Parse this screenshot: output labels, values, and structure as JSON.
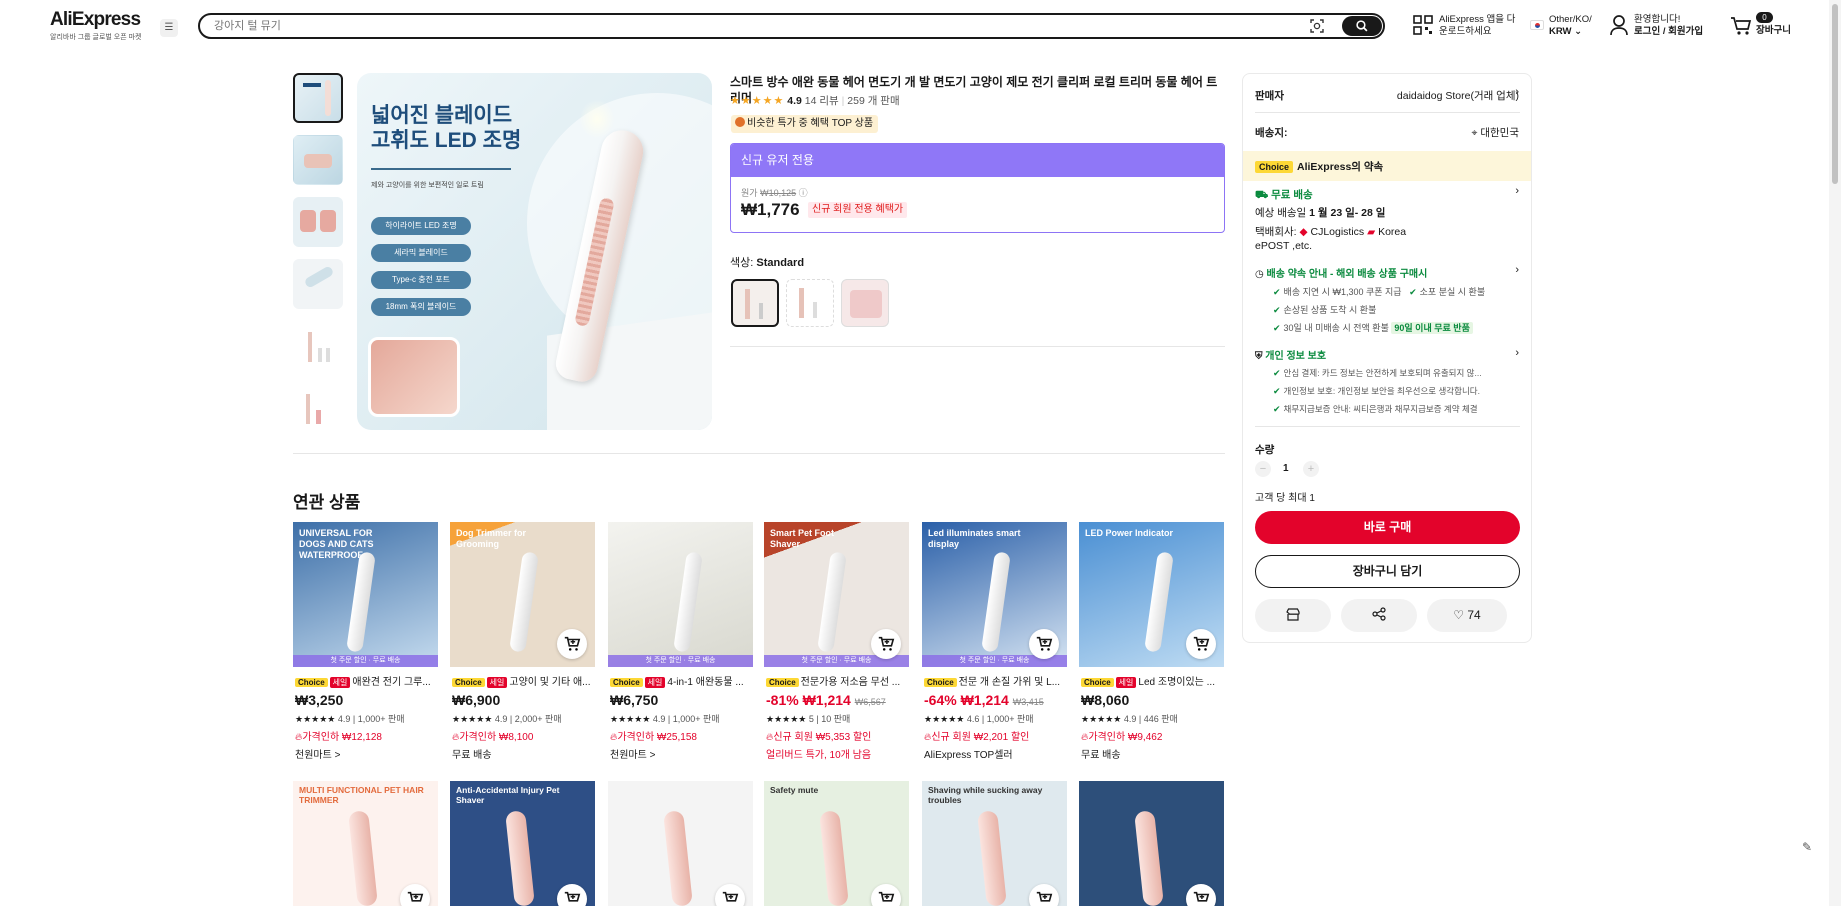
{
  "header": {
    "logo": "AliExpress",
    "logo_sub": "알리바바 그룹 글로벌 오픈 마켓",
    "search_placeholder": "강아지 털 뮤기",
    "app_line1": "AliExpress 앱을 다",
    "app_line2": "운로드하세요",
    "region_line1": "Other/KO/",
    "region_line2": "KRW",
    "account_line1": "환영합니다!",
    "account_line2": "로그인 / 회원가입",
    "cart_count": "0",
    "cart_label": "장바구니"
  },
  "product": {
    "title": "스마트 방수 애완 동물 헤어 면도기 개 발 면도기 고양이 제모 전기 클리퍼 로컬 트리머 동물 헤어 트리머",
    "rating": "4.9",
    "reviews": "14 리뷰",
    "sold": "259 개 판매",
    "badge": "비슷한 특가 중 혜택 TOP 상품",
    "promo_header": "신규 유저 전용",
    "orig_label": "원가",
    "orig_price": "₩10,125",
    "price": "₩1,776",
    "price_tag": "신규 회원 전용 혜택가",
    "color_label": "색상:",
    "color_value": "Standard",
    "main_image": {
      "heading_line1": "넓어진 블레이드",
      "heading_line2": "고휘도 LED 조명",
      "subtext": "제와 고양이를 위한 보편적인 일로 트림",
      "features": [
        "하이라이트 LED 조명",
        "세라믹 블레이드",
        "Type-c 충전 포트",
        "18mm 폭의 블레이드"
      ]
    }
  },
  "side": {
    "seller_label": "판매자",
    "seller_name": "daidaidog Store(거래 업체)",
    "ship_to_label": "배송지:",
    "ship_to": "대한민국",
    "choice_tag": "Choice",
    "promise_title": "AliExpress의 약속",
    "free_ship": "무료 배송",
    "est_label": "예상 배송일",
    "est_dates": "1 월 23 일- 28 일",
    "courier_label": "택배회사:",
    "courier1": "CJLogistics",
    "courier2": "Korea",
    "courier3": "ePOST ,etc.",
    "delivery_title": "배송 약속 안내 - 해외 배송 상품 구매시",
    "delivery_items": [
      "배송 지연 시 ₩1,300 쿠폰 지급",
      "소포 분실 시 환불",
      "손상된 상품 도착 시 환불",
      "30일 내 미배송 시 전액 환불"
    ],
    "delivery_badge": "90일 이내 무료 반품",
    "privacy_title": "개인 정보 보호",
    "privacy_items": [
      "안심 결제: 카드 정보는 안전하게 보호되며 유출되지 않...",
      "개인정보 보호: 개인정보 보안을 최우선으로 생각합니다.",
      "채무지급보증 안내: 씨티은행과 채무지급보증 계약 체결"
    ],
    "qty_label": "수량",
    "qty": "1",
    "qty_max": "고객 당 최대 1",
    "buy_now": "바로 구매",
    "add_cart": "장바구니 담기",
    "wish_count": "74"
  },
  "related": {
    "title": "연관 상품",
    "cards": [
      {
        "img_title": "UNIVERSAL FOR DOGS AND CATS WATERPROOF",
        "tags": [
          "Choice",
          "세일"
        ],
        "name": "애완견 전기 그루...",
        "price": "₩3,250",
        "old": "",
        "rating": "4.9",
        "sold": "1,000+ 판매",
        "line1": "가격인하 ₩12,128",
        "line2": "천원마트 >",
        "strip": "첫 주문 할인 · 무료 배송"
      },
      {
        "img_title": "Dog Trimmer for Grooming",
        "tags": [
          "Choice",
          "세일"
        ],
        "name": "고양이 및 기타 애...",
        "price": "₩6,900",
        "old": "",
        "rating": "4.9",
        "sold": "2,000+ 판매",
        "line1": "가격인하 ₩8,100",
        "line2": "무료 배송",
        "strip": ""
      },
      {
        "img_title": "",
        "tags": [
          "Choice",
          "세일"
        ],
        "name": "4-in-1 애완동물 ...",
        "price": "₩6,750",
        "old": "",
        "rating": "4.9",
        "sold": "1,000+ 판매",
        "line1": "가격인하 ₩25,158",
        "line2": "천원마트 >",
        "strip": "첫 주문 할인 · 무료 배송"
      },
      {
        "img_title": "Smart Pet Foot Shaver",
        "tags": [
          "Choice"
        ],
        "name": "전문가용 저소음 무선 ...",
        "price": "-81% ₩1,214",
        "old": "₩6,567",
        "rating": "5",
        "sold": "10 판매",
        "line1": "신규 회원 ₩5,353 할인",
        "line2": "얼리버드 특가, 10개 남음",
        "strip": "첫 주문 할인 · 무료 배송"
      },
      {
        "img_title": "Led illuminates smart display",
        "tags": [
          "Choice"
        ],
        "name": "전문 개 손질 가위 및 L...",
        "price": "-64% ₩1,214",
        "old": "₩3,415",
        "rating": "4.6",
        "sold": "1,000+ 판매",
        "line1": "신규 회원 ₩2,201 할인",
        "line2": "AliExpress TOP셀러",
        "strip": "첫 주문 할인 · 무료 배송"
      },
      {
        "img_title": "LED Power Indicator",
        "tags": [
          "Choice",
          "세일"
        ],
        "name": "Led 조명이있는 ...",
        "price": "₩8,060",
        "old": "",
        "rating": "4.9",
        "sold": "446 판매",
        "line1": "가격인하 ₩9,462",
        "line2": "무료 배송",
        "strip": ""
      }
    ],
    "row2_titles": [
      "MULTI FUNCTIONAL PET HAIR TRIMMER",
      "Anti-Accidental Injury Pet Shaver",
      "",
      "Safety mute",
      "Shaving while sucking away troubles",
      ""
    ]
  },
  "colors": {
    "brand_red": "#e3032b",
    "promo_purple": "#8f77f7",
    "choice_yellow": "#fdd835",
    "green": "#0a8a3e"
  }
}
